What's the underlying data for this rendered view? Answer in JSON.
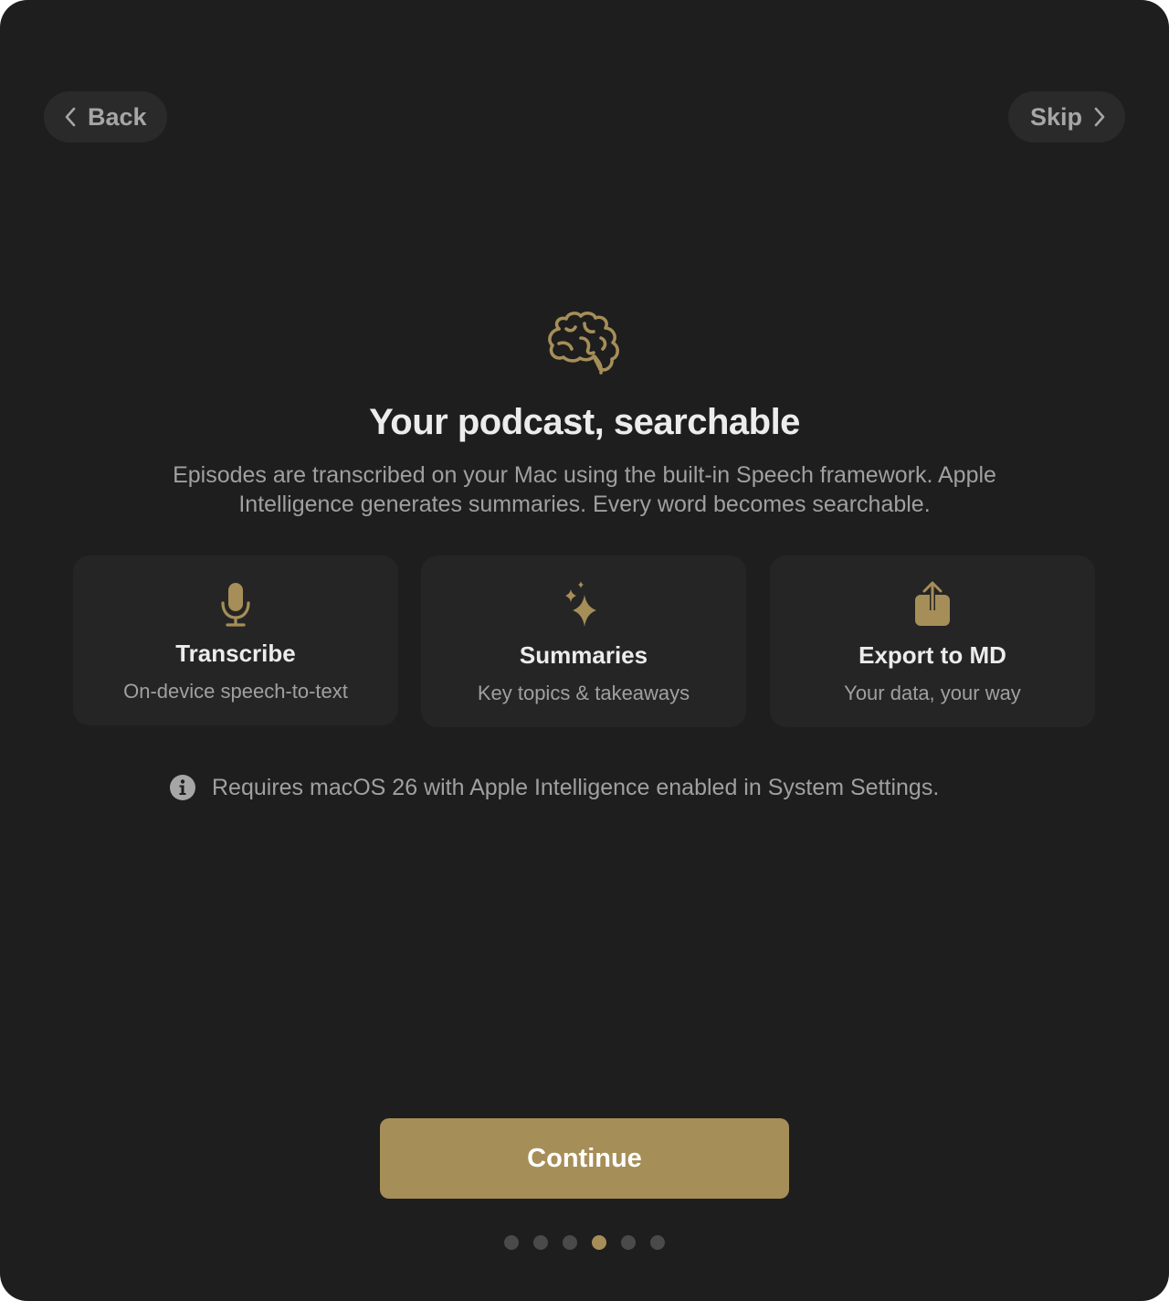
{
  "colors": {
    "background": "#1e1e1e",
    "accent": "#a68e58",
    "card": "#252525",
    "text_primary": "#ececec",
    "text_secondary": "#a0a0a0"
  },
  "nav": {
    "back_label": "Back",
    "skip_label": "Skip"
  },
  "hero": {
    "icon": "brain-icon",
    "title": "Your podcast, searchable",
    "subtitle": "Episodes are transcribed on your Mac using the built-in Speech framework. Apple Intelligence generates summaries. Every word becomes searchable."
  },
  "features": [
    {
      "icon": "microphone-icon",
      "title": "Transcribe",
      "description": "On-device speech-to-text"
    },
    {
      "icon": "sparkles-icon",
      "title": "Summaries",
      "description": "Key topics & takeaways"
    },
    {
      "icon": "share-icon",
      "title": "Export to MD",
      "description": "Your data, your way"
    }
  ],
  "note": {
    "icon": "info-icon",
    "text": "Requires macOS 26 with Apple Intelligence enabled in System Settings."
  },
  "continue_label": "Continue",
  "pagination": {
    "total": 6,
    "current": 4
  }
}
